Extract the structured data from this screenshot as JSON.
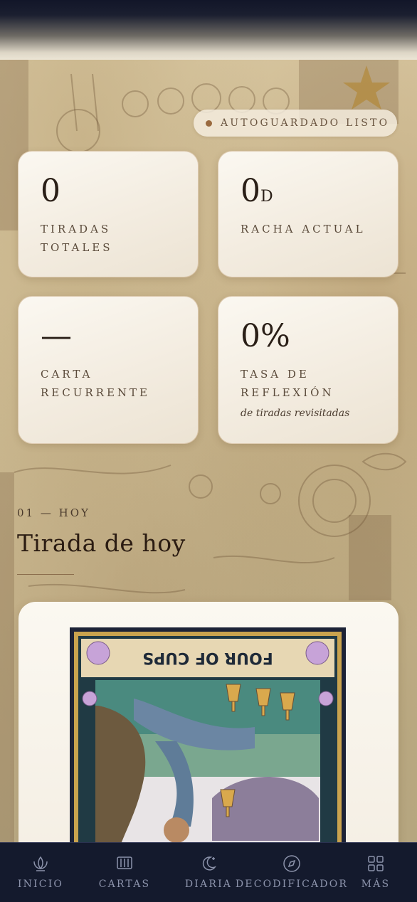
{
  "autosave": {
    "label": "AUTOGUARDADO LISTO"
  },
  "stats": [
    {
      "value": "0",
      "unit": "",
      "label_line1": "TIRADAS",
      "label_line2": "TOTALES",
      "sublabel": ""
    },
    {
      "value": "0",
      "unit": "D",
      "label_line1": "RACHA ACTUAL",
      "label_line2": "",
      "sublabel": ""
    },
    {
      "value": "—",
      "unit": "",
      "label_line1": "CARTA",
      "label_line2": "RECURRENTE",
      "sublabel": ""
    },
    {
      "value": "0%",
      "unit": "",
      "label_line1": "TASA DE",
      "label_line2": "REFLEXIÓN",
      "sublabel": "de tiradas revisitadas"
    }
  ],
  "section": {
    "number": "01 — HOY",
    "title": "Tirada de hoy"
  },
  "tarot_card": {
    "name": "FOUR OF CUPS",
    "orientation": "reversed"
  },
  "nav": [
    {
      "label": "INICIO",
      "icon": "lotus-icon"
    },
    {
      "label": "CARTAS",
      "icon": "cards-icon"
    },
    {
      "label": "DIARIA",
      "icon": "moon-star-icon"
    },
    {
      "label": "DECODIFICADOR",
      "icon": "compass-icon"
    },
    {
      "label": "MÁS",
      "icon": "grid-icon"
    }
  ],
  "colors": {
    "ink": "#2a1f17",
    "accent": "#9a6a3f",
    "nav_bg": "#141a2d",
    "nav_text": "#8c93ab"
  }
}
